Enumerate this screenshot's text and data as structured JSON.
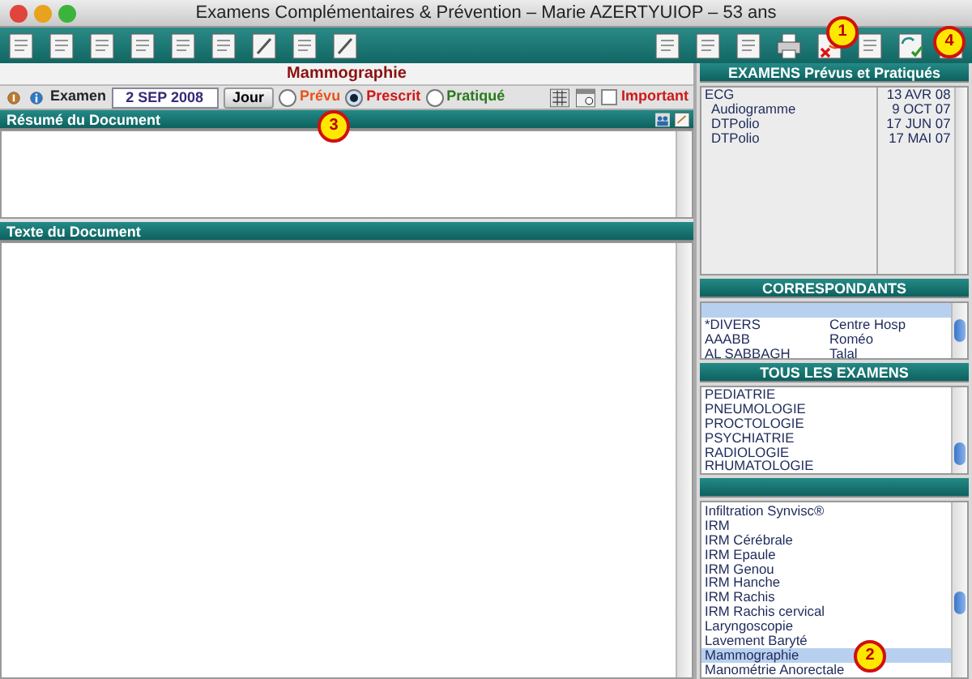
{
  "window": {
    "title": "Examens Complémentaires & Prévention – Marie AZERTYUIOP – 53 ans"
  },
  "document": {
    "title": "Mammographie",
    "exam_label": "Examen",
    "date": "2 SEP 2008",
    "today_button": "Jour",
    "status_options": [
      {
        "label": "Prévu",
        "selected": false,
        "color": "#e8541a"
      },
      {
        "label": "Prescrit",
        "selected": true,
        "color": "#d01818"
      },
      {
        "label": "Pratiqué",
        "selected": false,
        "color": "#2a7a1e"
      }
    ],
    "important": {
      "label": "Important",
      "checked": false
    },
    "summary_header": "Résumé du Document",
    "text_header": "Texte du Document"
  },
  "exams_done": {
    "header": "EXAMENS Prévus et Pratiqués",
    "rows": [
      {
        "name": "ECG",
        "date": "13 AVR 08"
      },
      {
        "name": "Audiogramme",
        "date": "9 OCT 07"
      },
      {
        "name": "DTPolio",
        "date": "17 JUN 07"
      },
      {
        "name": "DTPolio",
        "date": "17 MAI 07"
      }
    ]
  },
  "correspondents": {
    "header": "CORRESPONDANTS",
    "rows": [
      {
        "column_1": "*DIVERS",
        "column_2": "Centre Hosp"
      },
      {
        "column_1": "AAABB",
        "column_2": "Roméo"
      },
      {
        "column_1": "AL SABBAGH",
        "column_2": "Talal"
      }
    ]
  },
  "all_exams": {
    "header": "TOUS LES EXAMENS",
    "items": [
      "PEDIATRIE",
      "PNEUMOLOGIE",
      "PROCTOLOGIE",
      "PSYCHIATRIE",
      "RADIOLOGIE",
      "RHUMATOLOGIE"
    ]
  },
  "exam_types": {
    "items": [
      {
        "label": "Infiltration Synvisc®",
        "selected": false
      },
      {
        "label": "IRM",
        "selected": false
      },
      {
        "label": "IRM Cérébrale",
        "selected": false
      },
      {
        "label": "IRM Epaule",
        "selected": false
      },
      {
        "label": "IRM Genou",
        "selected": false
      },
      {
        "label": "IRM Hanche",
        "selected": false
      },
      {
        "label": "IRM Rachis",
        "selected": false
      },
      {
        "label": "IRM Rachis cervical",
        "selected": false
      },
      {
        "label": "Laryngoscopie",
        "selected": false
      },
      {
        "label": "Lavement Baryté",
        "selected": false
      },
      {
        "label": "Mammographie",
        "selected": true
      },
      {
        "label": "Manométrie Anorectale",
        "selected": false
      }
    ]
  },
  "callouts": [
    "1",
    "2",
    "3",
    "4"
  ]
}
